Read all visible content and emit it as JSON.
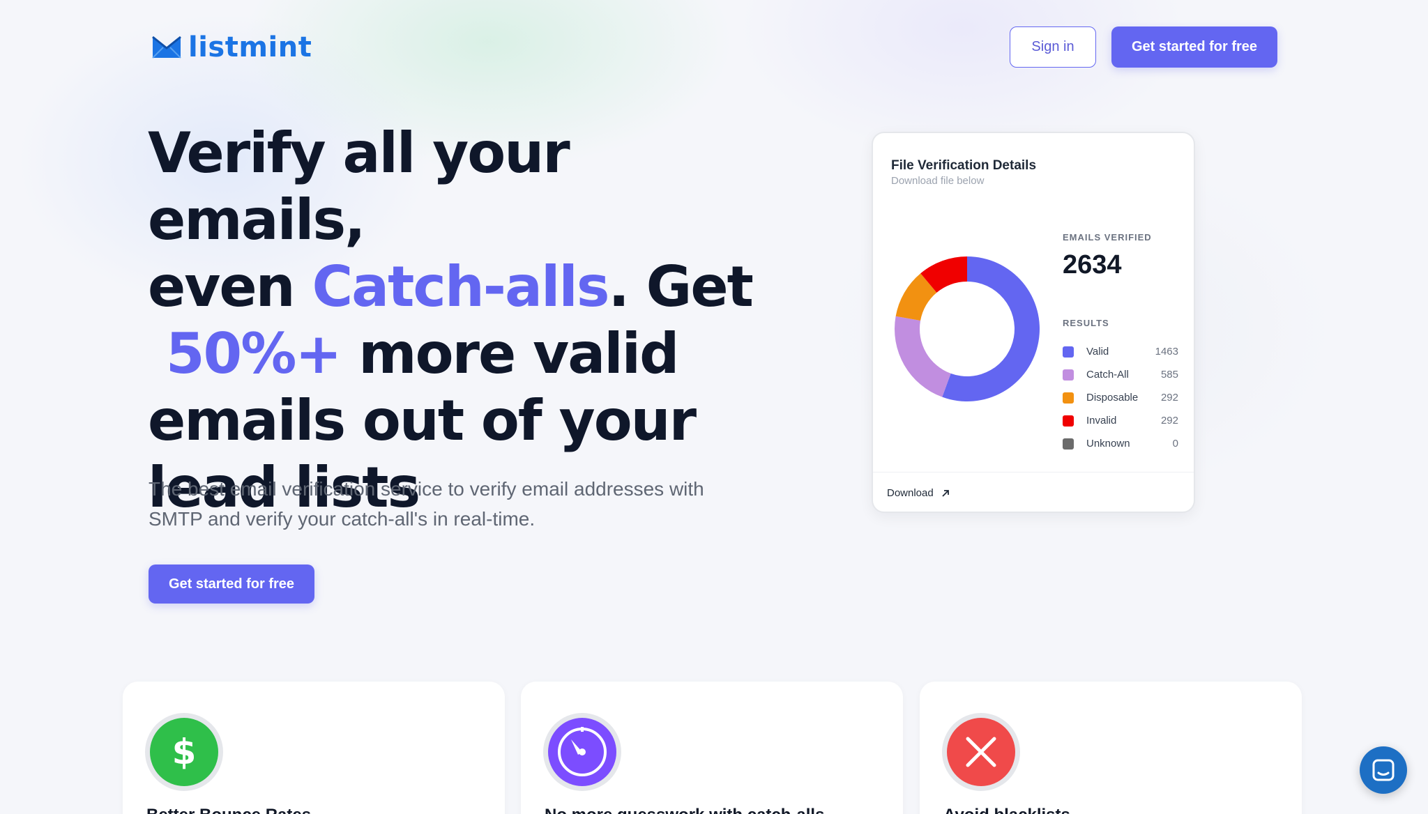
{
  "brand": {
    "name": "listmint",
    "color": "#1b74e4"
  },
  "header": {
    "sign_in": "Sign in",
    "cta": "Get started for free"
  },
  "hero": {
    "line1": "Verify all your emails,",
    "line2_pre": "even ",
    "line2_accent": "Catch-alls",
    "line2_post": ". Get",
    "line3_accent": "50%+",
    "line3_post": " more valid",
    "line4": "emails out of your",
    "line5": "lead lists",
    "subtitle": "The best email verification service to verify email addresses with SMTP and verify your catch-all's in real-time.",
    "cta": "Get started for free",
    "accent_color": "#6366f1"
  },
  "card": {
    "title": "File Verification Details",
    "subtitle": "Download file below",
    "verified_label": "EMAILS VERIFIED",
    "verified_count": "2634",
    "results_label": "RESULTS",
    "download_label": "Download",
    "download_icon": "arrow-up-right-icon"
  },
  "chart_data": {
    "type": "pie",
    "variant": "donut",
    "categories": [
      "Valid",
      "Catch-All",
      "Disposable",
      "Invalid",
      "Unknown"
    ],
    "values": [
      1463,
      585,
      292,
      292,
      0
    ],
    "colors": [
      "#6366f1",
      "#c18ee0",
      "#f29111",
      "#f00000",
      "#6b6b6b"
    ],
    "legend": "right"
  },
  "features": [
    {
      "icon": "dollar-icon",
      "color": "#2fbf4a",
      "title": "Better Bounce Rates"
    },
    {
      "icon": "timer-icon",
      "color": "#7c4dff",
      "title": "No more guesswork with catch-alls"
    },
    {
      "icon": "close-icon",
      "color": "#f04a4a",
      "title": "Avoid blacklists"
    }
  ],
  "chat": {
    "icon": "chat-icon"
  }
}
